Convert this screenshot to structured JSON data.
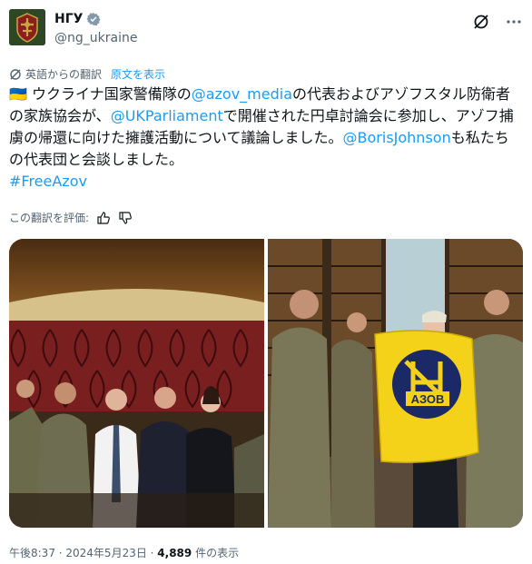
{
  "account": {
    "name": "НГУ",
    "handle": "@ng_ukraine"
  },
  "translation": {
    "label": "英語からの翻訳",
    "show_original": "原文を表示",
    "rate_label": "この翻訳を評価:"
  },
  "tweet": {
    "flag": "🇺🇦",
    "part1": " ウクライナ国家警備隊の",
    "mention_azov": "@azov_media",
    "part2": "の代表およびアゾフスタル防衛者の家族協会が、",
    "mention_parliament": "@UKParliament",
    "part3": "で開催された円卓討論会に参加し、アゾフ捕虜の帰還に向けた擁護活動について議論しました。",
    "mention_boris": "@BorisJohnson",
    "part4": "も私たちの代表団と会談しました。",
    "hashtag": "#FreeAzov"
  },
  "media": {
    "flag_text": "АЗОВ"
  },
  "footer": {
    "time": "午後8:37 · 2024年5月23日 · ",
    "views": "4,889",
    "views_label": " 件の表示"
  },
  "colors": {
    "link": "#1d9bf0",
    "verified": "#829aab",
    "muted": "#536471",
    "text": "#0f1419"
  },
  "icons": {
    "verified": "verified-badge-icon",
    "grok": "grok-icon",
    "more": "more-icon",
    "translate": "translate-icon",
    "thumbs_up": "thumbs-up-icon",
    "thumbs_down": "thumbs-down-icon"
  }
}
